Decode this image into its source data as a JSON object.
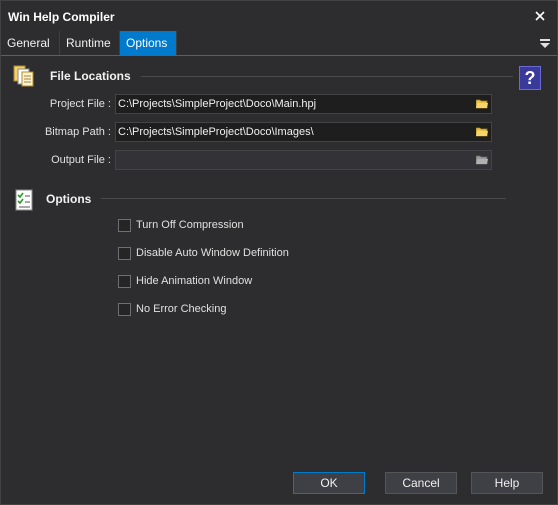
{
  "window": {
    "title": "Win Help Compiler"
  },
  "tabs": [
    {
      "label": "General",
      "active": false
    },
    {
      "label": "Runtime",
      "active": false
    },
    {
      "label": "Options",
      "active": true
    }
  ],
  "file_locations": {
    "title": "File Locations",
    "fields": [
      {
        "label": "Project File :",
        "value": "C:\\Projects\\SimpleProject\\Doco\\Main.hpj",
        "enabled": true
      },
      {
        "label": "Bitmap Path :",
        "value": "C:\\Projects\\SimpleProject\\Doco\\Images\\",
        "enabled": true
      },
      {
        "label": "Output File :",
        "value": "",
        "enabled": false
      }
    ]
  },
  "options": {
    "title": "Options",
    "checkboxes": [
      {
        "label": "Turn Off Compression",
        "checked": false
      },
      {
        "label": "Disable Auto Window Definition",
        "checked": false
      },
      {
        "label": "Hide Animation Window",
        "checked": false
      },
      {
        "label": "No Error Checking",
        "checked": false
      }
    ]
  },
  "help_icon_glyph": "?",
  "buttons": {
    "ok": "OK",
    "cancel": "Cancel",
    "help": "Help"
  },
  "colors": {
    "accent": "#007acc",
    "background": "#2d2d30",
    "input_bg": "#1e1e1e"
  },
  "icons": [
    "close-icon",
    "tab-menu-icon",
    "file-locations-icon",
    "options-checklist-icon",
    "help-icon",
    "folder-browse-icon"
  ]
}
